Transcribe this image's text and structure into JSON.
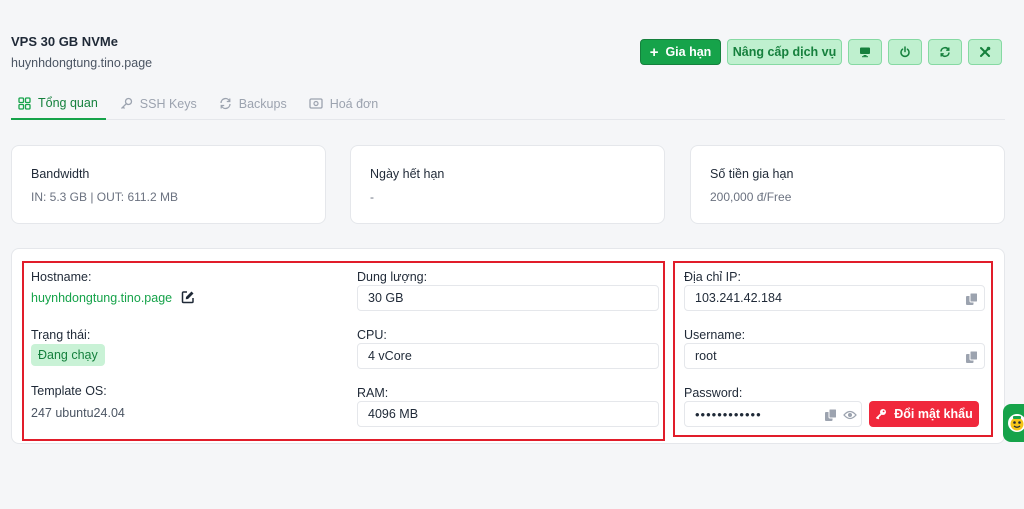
{
  "header": {
    "title": "VPS 30 GB NVMe",
    "subtitle": "huynhdongtung.tino.page"
  },
  "actions": {
    "renew_label": "Gia hạn",
    "upgrade_label": "Nâng cấp dịch vụ",
    "icons": [
      "monitor-icon",
      "power-icon",
      "refresh-icon",
      "tools-icon"
    ]
  },
  "tabs": [
    {
      "label": "Tổng quan",
      "icon": "grid-icon",
      "active": true
    },
    {
      "label": "SSH Keys",
      "icon": "key-icon",
      "active": false
    },
    {
      "label": "Backups",
      "icon": "refresh-icon",
      "active": false
    },
    {
      "label": "Hoá đơn",
      "icon": "invoice-icon",
      "active": false
    }
  ],
  "stats": [
    {
      "label": "Bandwidth",
      "value": "IN: 5.3 GB | OUT: 611.2 MB"
    },
    {
      "label": "Ngày hết hạn",
      "value": "-"
    },
    {
      "label": "Số tiền gia hạn",
      "value": "200,000 đ/Free"
    }
  ],
  "details": {
    "hostname_label": "Hostname:",
    "hostname_value": "huynhdongtung.tino.page",
    "status_label": "Trạng thái:",
    "status_value": "Đang chạy",
    "os_label": "Template OS:",
    "os_value": "247 ubuntu24.04",
    "storage_label": "Dung lượng:",
    "storage_value": "30 GB",
    "cpu_label": "CPU:",
    "cpu_value": "4 vCore",
    "ram_label": "RAM:",
    "ram_value": "4096 MB"
  },
  "access": {
    "ip_label": "Địa chỉ IP:",
    "ip_value": "103.241.42.184",
    "username_label": "Username:",
    "username_value": "root",
    "password_label": "Password:",
    "password_value": "••••••••••••",
    "change_password_label": "Đổi mật khẩu"
  },
  "colors": {
    "brand_green": "#16a34a",
    "danger_red": "#f0283c",
    "highlight_red": "#e11d2a"
  }
}
